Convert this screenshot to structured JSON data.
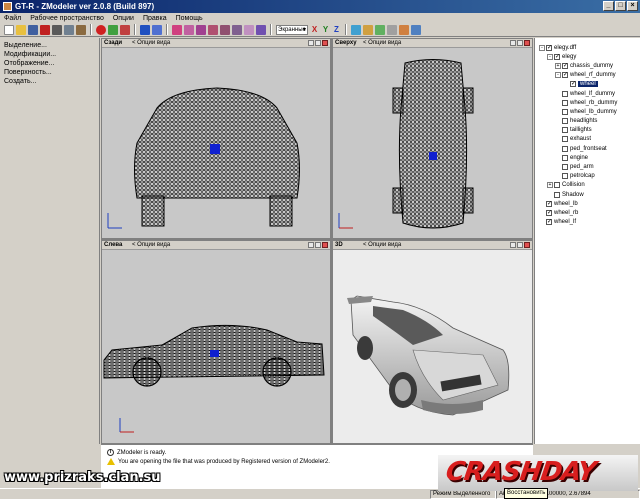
{
  "window": {
    "title": "GT-R - ZModeler ver 2.0.8 (Build 897)"
  },
  "menu": [
    "Файл",
    "Рабочее пространство",
    "Опции",
    "Правка",
    "Помощь"
  ],
  "toolbar": {
    "view_select": "Экранные",
    "axes": [
      "X",
      "Y",
      "Z"
    ]
  },
  "left_panel": [
    "Выделение...",
    "Модификации...",
    "Отображение...",
    "Поверхность...",
    "Создать..."
  ],
  "viewports": [
    {
      "name": "Сзади",
      "options": "< Опции вида"
    },
    {
      "name": "Сверху",
      "options": "< Опции вида"
    },
    {
      "name": "Слева",
      "options": "< Опции вида"
    },
    {
      "name": "3D",
      "options": "< Опции вида"
    }
  ],
  "tree": [
    {
      "label": "elegy.dff",
      "depth": 0,
      "exp": "-",
      "checked": true
    },
    {
      "label": "elegy",
      "depth": 1,
      "exp": "-",
      "checked": true
    },
    {
      "label": "chassis_dummy",
      "depth": 2,
      "exp": "+",
      "checked": true
    },
    {
      "label": "wheel_rf_dummy",
      "depth": 2,
      "exp": "-",
      "checked": true
    },
    {
      "label": "wheel",
      "depth": 3,
      "exp": "",
      "checked": true,
      "selected": true
    },
    {
      "label": "wheel_lf_dummy",
      "depth": 2,
      "exp": "",
      "checked": false
    },
    {
      "label": "wheel_rb_dummy",
      "depth": 2,
      "exp": "",
      "checked": false
    },
    {
      "label": "wheel_lb_dummy",
      "depth": 2,
      "exp": "",
      "checked": false
    },
    {
      "label": "headlights",
      "depth": 2,
      "exp": "",
      "checked": false
    },
    {
      "label": "taillights",
      "depth": 2,
      "exp": "",
      "checked": false
    },
    {
      "label": "exhaust",
      "depth": 2,
      "exp": "",
      "checked": false
    },
    {
      "label": "ped_frontseat",
      "depth": 2,
      "exp": "",
      "checked": false
    },
    {
      "label": "engine",
      "depth": 2,
      "exp": "",
      "checked": false
    },
    {
      "label": "ped_arm",
      "depth": 2,
      "exp": "",
      "checked": false
    },
    {
      "label": "petrolcap",
      "depth": 2,
      "exp": "",
      "checked": false
    },
    {
      "label": "Collision",
      "depth": 1,
      "exp": "+",
      "checked": false
    },
    {
      "label": "Shadow",
      "depth": 1,
      "exp": "",
      "checked": false
    },
    {
      "label": "wheel_lb",
      "depth": 0,
      "exp": "",
      "checked": true
    },
    {
      "label": "wheel_rb",
      "depth": 0,
      "exp": "",
      "checked": true
    },
    {
      "label": "wheel_lf",
      "depth": 0,
      "exp": "",
      "checked": true
    }
  ],
  "status": {
    "line1": "ZModeler is ready.",
    "line2": "You are opening the file that was produced by Registered version of ZModeler2."
  },
  "bottom": {
    "watermark": "www.prizraks.clan.su",
    "logo": "CRASHDAY",
    "mode": "Режим Выделенного",
    "auto": "Авто",
    "coords": "0.51098, 0.00000, 2.67894",
    "tooltip": "Восстановить"
  },
  "colors": {
    "title_start": "#0a246a",
    "title_end": "#3a6ea5",
    "logo_red": "#d81e1e",
    "wire": "#000000"
  }
}
